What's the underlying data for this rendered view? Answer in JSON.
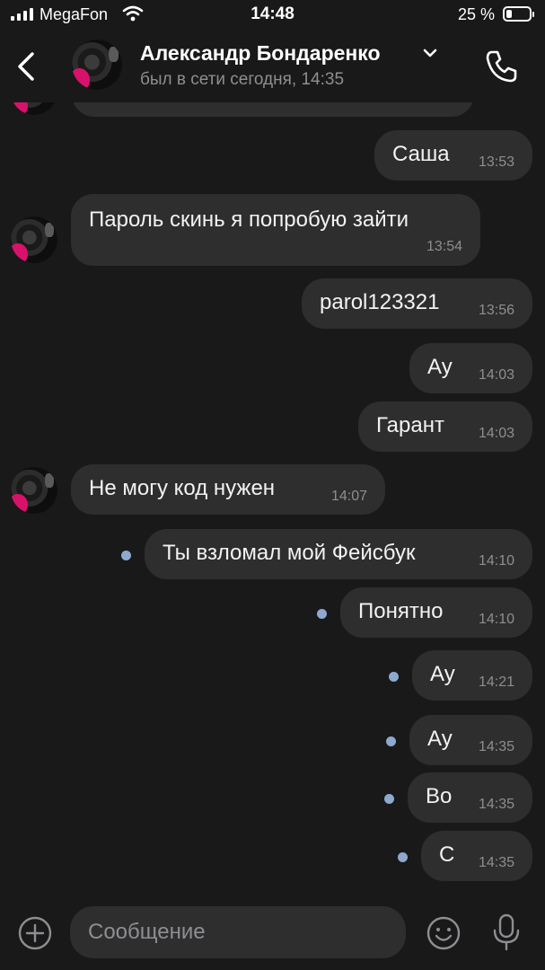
{
  "status_bar": {
    "carrier": "MegaFon",
    "time": "14:48",
    "battery": "25 %",
    "battery_level": 0.25
  },
  "header": {
    "name": "Александр Бондаренко",
    "presence": "был в сети сегодня, 14:35",
    "icons": {
      "back": "chevron-left-icon",
      "expand": "chevron-down-icon",
      "call": "phone-icon"
    }
  },
  "messages": [
    {
      "dir": "out",
      "text": "Саша",
      "time": "13:53"
    },
    {
      "dir": "in",
      "text": "Пароль скинь я попробую зайти",
      "time": "13:54"
    },
    {
      "dir": "out",
      "text": "parol123321",
      "time": "13:56"
    },
    {
      "dir": "out",
      "text": "Ау",
      "time": "14:03"
    },
    {
      "dir": "out",
      "text": "Гарант",
      "time": "14:03"
    },
    {
      "dir": "in",
      "text": "Не могу код нужен",
      "time": "14:07"
    },
    {
      "dir": "out",
      "text": "Ты взломал мой Фейсбук",
      "time": "14:10",
      "unread": true
    },
    {
      "dir": "out",
      "text": "Понятно",
      "time": "14:10",
      "unread": true
    },
    {
      "dir": "out",
      "text": "Ау",
      "time": "14:21",
      "unread": true
    },
    {
      "dir": "out",
      "text": "Ау",
      "time": "14:35",
      "unread": true
    },
    {
      "dir": "out",
      "text": "Во",
      "time": "14:35",
      "unread": true
    },
    {
      "dir": "out",
      "text": "С",
      "time": "14:35",
      "unread": true
    }
  ],
  "composer": {
    "placeholder": "Сообщение",
    "icons": {
      "attach": "plus-circle-icon",
      "emoji": "smiley-icon",
      "voice": "microphone-icon"
    }
  },
  "colors": {
    "background": "#191919",
    "bubble": "#2e2e2e",
    "unread_dot": "#8ea9cf",
    "secondary_text": "#8e8e93"
  }
}
